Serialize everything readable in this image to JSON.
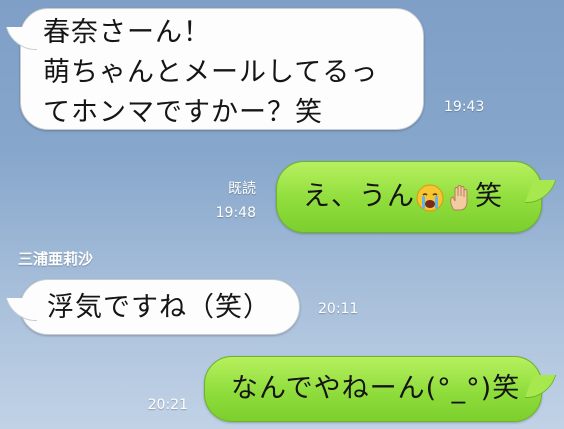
{
  "messages": [
    {
      "direction": "incoming",
      "lines": [
        "春奈さーん！",
        "萌ちゃんとメールしてるっ",
        "てホンマですかー？笑"
      ],
      "time": "19:43"
    },
    {
      "direction": "outgoing",
      "text_before": "え、うん",
      "emojis": [
        "crying-face-icon",
        "raised-hand-icon"
      ],
      "text_after": "笑",
      "read_status": "既読",
      "time": "19:48"
    },
    {
      "direction": "incoming",
      "sender": "三浦亜莉沙",
      "text": "浮気ですね（笑）",
      "time": "20:11"
    },
    {
      "direction": "outgoing",
      "text": "なんでやねーん(°_°)笑",
      "time": "20:21"
    }
  ],
  "colors": {
    "background_top": "#7f9fc7",
    "background_bottom": "#c1d2e6",
    "incoming_bubble": "#fdfdfd",
    "outgoing_bubble": "#8fdd3c",
    "meta_text": "#ffffff"
  }
}
